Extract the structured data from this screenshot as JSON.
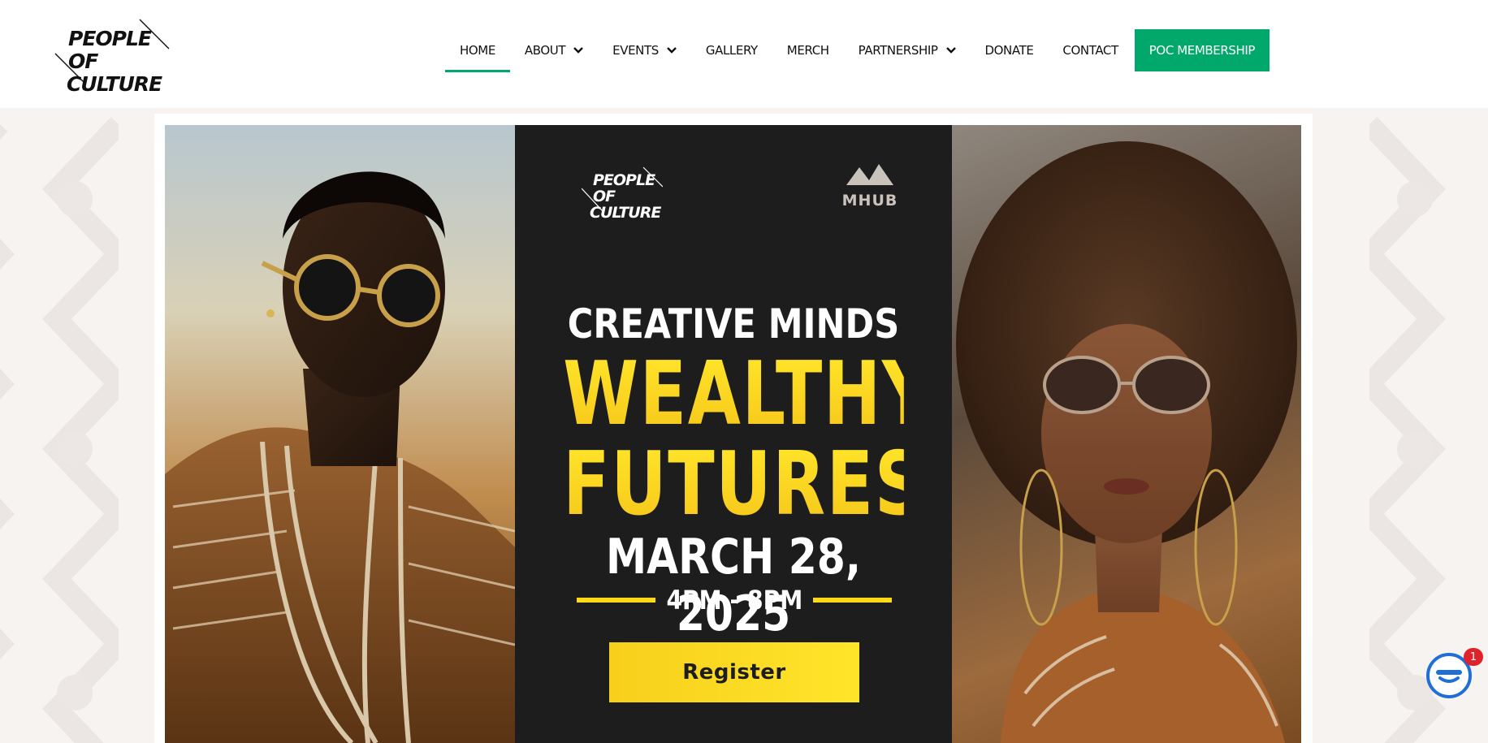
{
  "header": {
    "logo": {
      "line1": "PEOPLE OF",
      "line2": "CULTURE"
    },
    "nav": [
      {
        "label": "HOME",
        "active": true,
        "dropdown": false
      },
      {
        "label": "ABOUT",
        "active": false,
        "dropdown": true
      },
      {
        "label": "EVENTS",
        "active": false,
        "dropdown": true
      },
      {
        "label": "GALLERY",
        "active": false,
        "dropdown": false
      },
      {
        "label": "MERCH",
        "active": false,
        "dropdown": false
      },
      {
        "label": "PARTNERSHIP",
        "active": false,
        "dropdown": true
      },
      {
        "label": "DONATE",
        "active": false,
        "dropdown": false
      },
      {
        "label": "CONTACT",
        "active": false,
        "dropdown": false
      }
    ],
    "cta_label": "POC MEMBERSHIP"
  },
  "hero": {
    "poster_logo": {
      "line1": "PEOPLE OF",
      "line2": "CULTURE"
    },
    "partner_logo": "MHUB",
    "title_line1": "CREATIVE MINDS",
    "title_line2": "WEALTHY",
    "title_line3": "FUTURES",
    "date": "MARCH 28, 2025",
    "time": "4PM - 8PM",
    "register_label": "Register",
    "left_image": "man-portrait-photo",
    "right_image": "woman-portrait-photo"
  },
  "chat": {
    "badge_count": "1"
  },
  "colors": {
    "accent_green": "#00a86b",
    "poster_yellow": "#ffd916",
    "poster_bg": "#1e1d1e",
    "chat_blue": "#1f6fd6",
    "badge_red": "#e0222b"
  }
}
